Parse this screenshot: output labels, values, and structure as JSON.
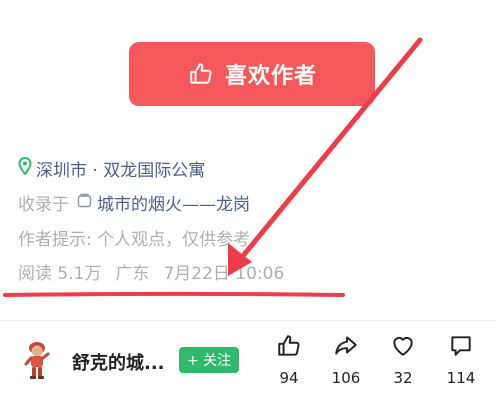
{
  "like_button": {
    "label": "喜欢作者",
    "icon": "thumbs-up-icon"
  },
  "meta": {
    "location": "深圳市 · 双龙国际公寓",
    "location_icon": "location-pin-icon",
    "collection_prefix": "收录于",
    "collection_icon": "folder-icon",
    "collection_name": "城市的烟火——龙岗",
    "tip": "作者提示: 个人观点，仅供参考",
    "reads": "阅读 5.1万",
    "region": "广东",
    "date": "7月22日 10:06"
  },
  "author": {
    "name": "舒克的城...",
    "follow_label": "+ 关注"
  },
  "actions": {
    "like_count": "94",
    "share_count": "106",
    "favorite_count": "32",
    "comment_count": "114"
  },
  "colors": {
    "accent_red": "#f4585a",
    "link_blue": "#4b5f8e",
    "follow_green": "#2fb96a",
    "annotation_red": "#ef3b4a"
  }
}
